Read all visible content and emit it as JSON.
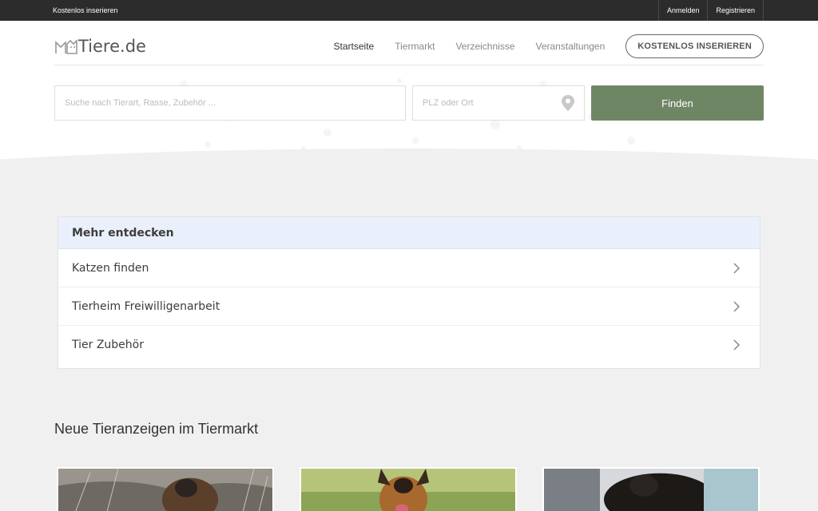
{
  "topbar": {
    "left_label": "Kostenlos inserieren",
    "login": "Anmelden",
    "register": "Registrieren"
  },
  "header": {
    "logo_text": "Tiere.de",
    "nav": [
      "Startseite",
      "Tiermarkt",
      "Verzeichnisse",
      "Veranstaltungen"
    ],
    "active_nav": "Startseite",
    "cta": "KOSTENLOS INSERIEREN"
  },
  "search": {
    "query_placeholder": "Suche nach Tierart, Rasse, Zubehör ...",
    "location_placeholder": "PLZ oder Ort",
    "submit": "Finden"
  },
  "discover": {
    "title": "Mehr entdecken",
    "items": [
      "Katzen finden",
      "Tierheim Freiwilligenarbeit",
      "Tier Zubehör"
    ]
  },
  "listings": {
    "title": "Neue Tieranzeigen im Tiermarkt"
  },
  "colors": {
    "accent": "#6f8665",
    "topbar": "#2c2c2c",
    "card_header": "#eaf0fb"
  }
}
